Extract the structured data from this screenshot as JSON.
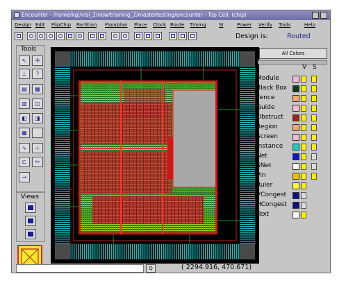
{
  "window": {
    "title": "Encounter - /home/kgj/vlsi_2/new/training_2/mastertesting/encounter - Top Cell: (chip)"
  },
  "menu": [
    "Design",
    "Edit",
    "FlipChip",
    "Partition",
    "Floorplan",
    "Place",
    "Clock",
    "Route",
    "Timing",
    "SI",
    "Power",
    "Verify",
    "Tools",
    "Help"
  ],
  "toolbar": {
    "design_label": "Design is:",
    "design_state": "Routed"
  },
  "tools_title": "Tools",
  "views_title": "Views",
  "layers": {
    "all_colors_label": "All Colors",
    "v_label": "V",
    "s_label": "S",
    "items": [
      {
        "name": "Module",
        "color": "#f0b8d8"
      },
      {
        "name": "Black Box",
        "color": "#0f3d22"
      },
      {
        "name": "Fence",
        "color": "#f5a870"
      },
      {
        "name": "Guide",
        "color": "#f0b8d8"
      },
      {
        "name": "Obstruct",
        "color": "#a52020"
      },
      {
        "name": "Region",
        "color": "#f5a870"
      },
      {
        "name": "Screen",
        "color": "#f0b8d8"
      },
      {
        "name": "Instance",
        "color": "#20c8c8"
      },
      {
        "name": "Net",
        "color": "#1010e0"
      },
      {
        "name": "SNet",
        "color": "#ffffff"
      },
      {
        "name": "Pin",
        "color": "#f0c000"
      },
      {
        "name": "Ruler",
        "color": "#ffff20"
      },
      {
        "name": "VCongest",
        "color": "#101080"
      },
      {
        "name": "HCongest",
        "color": "#101080"
      },
      {
        "name": "Text",
        "color": "#ffffff"
      }
    ]
  },
  "status": {
    "query_label": "Q",
    "coordinates": "(  2294.916,    470.671)"
  }
}
